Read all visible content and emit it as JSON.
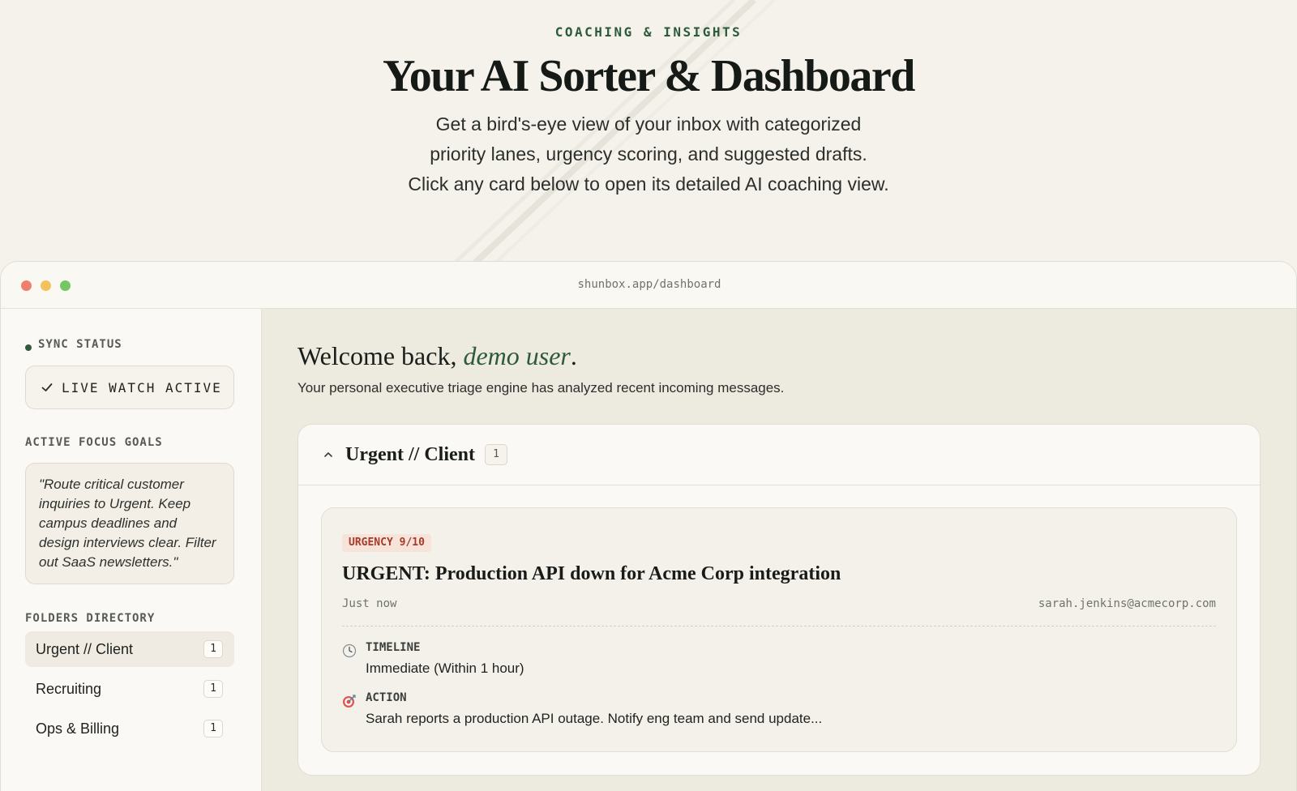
{
  "hero": {
    "eyebrow": "COACHING & INSIGHTS",
    "title": "Your AI Sorter & Dashboard",
    "description_lines": [
      "Get a bird's-eye view of your inbox with categorized",
      "priority lanes, urgency scoring, and suggested drafts.",
      "Click any card below to open its detailed AI coaching view."
    ]
  },
  "window": {
    "url": "shunbox.app/dashboard"
  },
  "sidebar": {
    "sync_label": "SYNC STATUS",
    "sync_value": "LIVE WATCH ACTIVE",
    "goals_label": "ACTIVE FOCUS GOALS",
    "goals_text": "\"Route critical customer inquiries to Urgent. Keep campus deadlines and design interviews clear. Filter out SaaS newsletters.\"",
    "folders_label": "FOLDERS DIRECTORY",
    "folders": [
      {
        "label": "Urgent // Client",
        "count": "1",
        "active": true
      },
      {
        "label": "Recruiting",
        "count": "1",
        "active": false
      },
      {
        "label": "Ops & Billing",
        "count": "1",
        "active": false
      }
    ]
  },
  "main": {
    "welcome_prefix": "Welcome back, ",
    "welcome_name": "demo user",
    "welcome_suffix": ".",
    "subtitle": "Your personal executive triage engine has analyzed recent incoming messages.",
    "lane": {
      "title": "Urgent // Client",
      "count": "1",
      "card": {
        "urgency": "URGENCY 9/10",
        "subject": "URGENT: Production API down for Acme Corp integration",
        "time": "Just now",
        "sender": "sarah.jenkins@acmecorp.com",
        "timeline_label": "TIMELINE",
        "timeline_value": "Immediate (Within 1 hour)",
        "action_label": "ACTION",
        "action_value": "Sarah reports a production API outage. Notify eng team and send update..."
      }
    }
  },
  "colors": {
    "accent_green": "#2c5a3a",
    "urgency_red": "#a83a2a",
    "background": "#f5f2eb"
  },
  "icons": [
    "check-icon",
    "chevron-up-icon",
    "clock-icon",
    "target-icon"
  ]
}
